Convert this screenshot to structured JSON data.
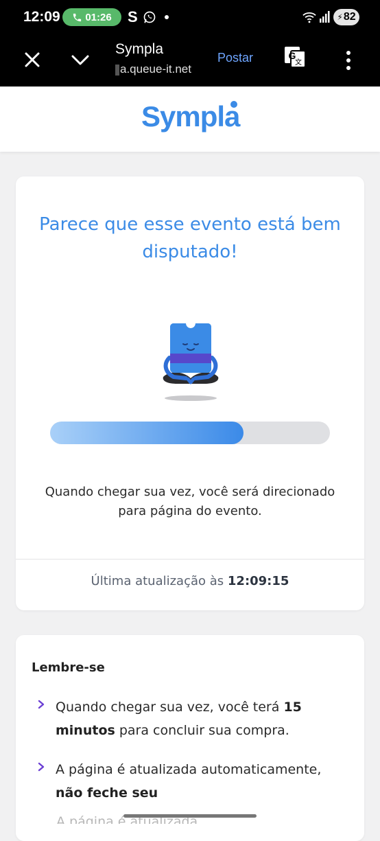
{
  "status_bar": {
    "time": "12:09",
    "call_duration": "01:26",
    "app_letter": "S",
    "battery": "82"
  },
  "toolbar": {
    "title": "Sympla",
    "url": "a.queue-it.net",
    "action_label": "Postar"
  },
  "header": {
    "logo_text": "Sympla"
  },
  "queue": {
    "headline": "Parece que esse evento está bem disputado!",
    "progress": 0.69,
    "message": "Quando chegar sua vez, você será direcionado para página do evento.",
    "last_update_label": "Última atualização às",
    "last_update_time": "12:09:15"
  },
  "remember": {
    "title": "Lembre-se",
    "item1": {
      "before": "Quando chegar sua vez, você terá ",
      "bold": "15 minutos",
      "after": " para concluir sua compra."
    },
    "item2": {
      "before": "A página é atualizada automaticamente, ",
      "bold": "não feche seu"
    },
    "cut_text": "A página é atualizada"
  },
  "colors": {
    "brand": "#3b8be6",
    "progress_track": "#dfe0e3",
    "background": "#f1f1f2"
  }
}
